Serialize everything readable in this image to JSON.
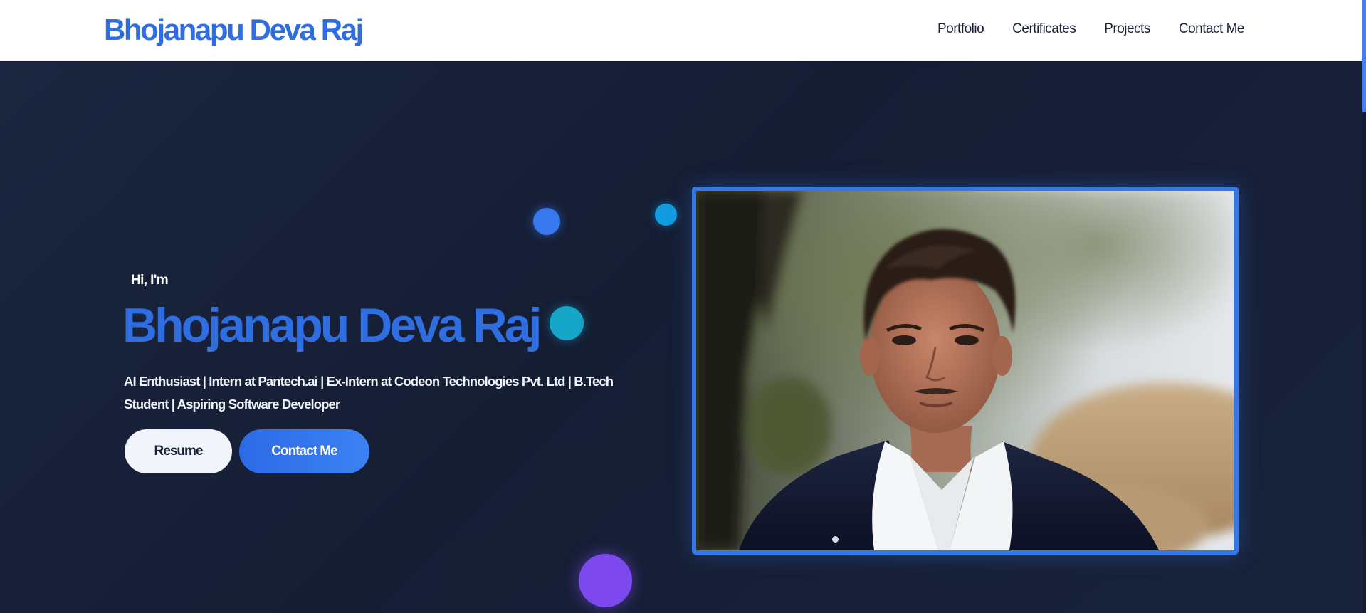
{
  "header": {
    "brand": "Bhojanapu Deva Raj",
    "nav": [
      {
        "label": "Portfolio"
      },
      {
        "label": "Certificates"
      },
      {
        "label": "Projects"
      },
      {
        "label": "Contact Me"
      }
    ]
  },
  "hero": {
    "greeting": "Hi, I'm",
    "name": "Bhojanapu Deva Raj",
    "tagline": "AI Enthusiast | Intern at Pantech.ai | Ex-Intern at Codeon Technologies Pvt. Ltd | B.Tech Student | Aspiring Software Developer",
    "buttons": {
      "resume": "Resume",
      "contact": "Contact Me"
    },
    "photo_alt": "Portrait of Bhojanapu Deva Raj"
  },
  "colors": {
    "accent": "#2f6ee0",
    "background": "#17213a",
    "header_bg": "#ffffff",
    "frame": "#3577e6",
    "bubble_blue": "#3778ef",
    "bubble_cyan": "#139be0",
    "bubble_teal": "#15a6c8",
    "bubble_purple": "#7d48ee"
  },
  "icons": [
    "portrait-photo"
  ]
}
